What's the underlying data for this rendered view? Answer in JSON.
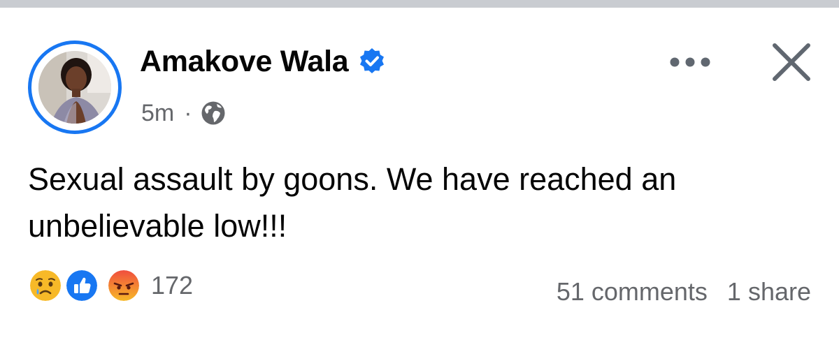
{
  "post": {
    "author": "Amakove Wala",
    "verified": true,
    "timestamp": "5m",
    "separator": "·",
    "audience_icon": "globe-icon",
    "text": "Sexual assault by goons. We have reached an unbelievable low!!!",
    "reactions": {
      "types": [
        "sad-reaction-icon",
        "like-reaction-icon",
        "angry-reaction-icon"
      ],
      "count": "172"
    },
    "comments": "51 comments",
    "shares": "1 share"
  },
  "colors": {
    "accent": "#1877f2",
    "text_primary": "#050505",
    "text_secondary": "#65676b",
    "top_strip": "#c9ccd1"
  },
  "icons": {
    "more": "more-options-icon",
    "close": "close-icon",
    "verified": "verified-badge-icon"
  }
}
